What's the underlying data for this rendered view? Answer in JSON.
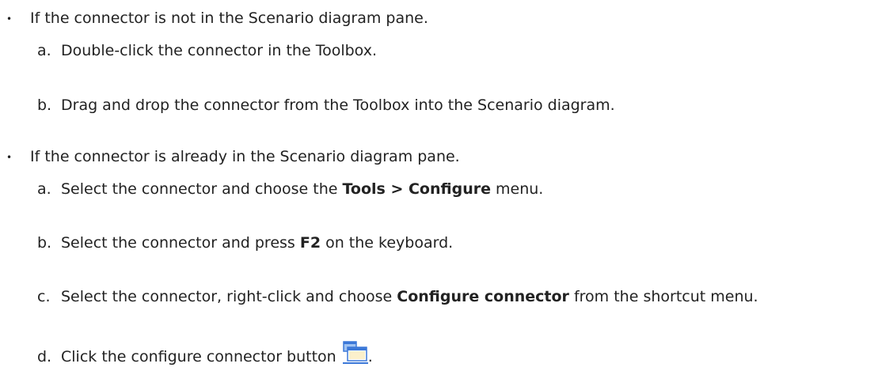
{
  "list": {
    "bullet_glyph": "•",
    "bullet1": "If the connector is not in the Scenario diagram pane.",
    "bullet1_steps": {
      "a_letter": "a.",
      "a_text": "Double-click the connector in the Toolbox.",
      "b_letter": "b.",
      "b_text": "Drag and drop the connector from the Toolbox into the Scenario diagram."
    },
    "bullet2": "If the connector is already in the Scenario diagram pane.",
    "bullet2_steps": {
      "a_letter": "a.",
      "a_text_before": "Select the connector and choose the ",
      "a_bold": "Tools > Configure",
      "a_text_after": " menu.",
      "b_letter": "b.",
      "b_text_before": "Select the connector and press ",
      "b_bold": "F2",
      "b_text_after": " on the keyboard.",
      "c_letter": "c.",
      "c_text_before": "Select the connector, right-click and choose ",
      "c_bold": "Configure connector",
      "c_text_after": " from the shortcut menu.",
      "d_letter": "d.",
      "d_text_before": "Click the configure connector button ",
      "d_text_after": "."
    }
  },
  "icons": {
    "configure_connector": "configure-connector-icon",
    "colors": {
      "window_blue": "#3c78d8",
      "window_light": "#9fc3f2",
      "panel_yellow": "#f4d46a",
      "window_white": "#ffffff"
    }
  }
}
